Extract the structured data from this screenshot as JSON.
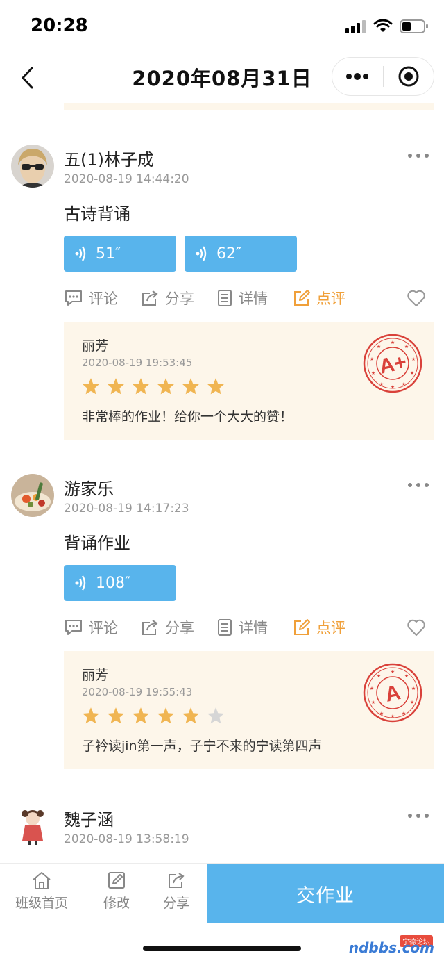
{
  "status_bar": {
    "time": "20:28"
  },
  "nav": {
    "title": "2020年08月31日"
  },
  "posts": [
    {
      "name": "五(1)林子成",
      "time": "2020-08-19 14:44:20",
      "text": "古诗背诵",
      "audios": [
        "51″",
        "62″"
      ],
      "actions": {
        "comment": "评论",
        "share": "分享",
        "detail": "详情",
        "review": "点评"
      },
      "review": {
        "name": "丽芳",
        "time": "2020-08-19 19:53:45",
        "stars": 6,
        "comment": "非常棒的作业！给你一个大大的赞！",
        "grade": "A+"
      }
    },
    {
      "name": "游家乐",
      "time": "2020-08-19 14:17:23",
      "text": "背诵作业",
      "audios": [
        "108″"
      ],
      "actions": {
        "comment": "评论",
        "share": "分享",
        "detail": "详情",
        "review": "点评"
      },
      "review": {
        "name": "丽芳",
        "time": "2020-08-19 19:55:43",
        "stars": 5,
        "comment": "子衿读jin第一声，子宁不来的宁读第四声",
        "grade": "A"
      }
    },
    {
      "name": "魏子涵",
      "time": "2020-08-19 13:58:19"
    }
  ],
  "bottom_bar": {
    "home": "班级首页",
    "edit": "修改",
    "share": "分享",
    "submit": "交作业"
  },
  "watermark": {
    "text": "ndbbs.com",
    "tag": "宁德论坛"
  },
  "colors": {
    "accent": "#58b4ec",
    "orange": "#f0a03a",
    "star": "#f0b552",
    "review_bg": "#fdf6ea",
    "stamp": "#d9413a"
  }
}
